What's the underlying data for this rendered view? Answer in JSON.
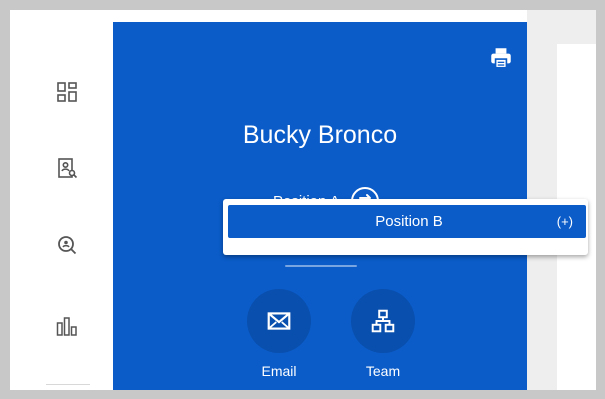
{
  "profile": {
    "name": "Bucky Bronco",
    "current_position": "Position A"
  },
  "dropdown": {
    "options": [
      {
        "label": "Position B",
        "badge": "(+)"
      }
    ]
  },
  "actions": [
    {
      "label": "Email",
      "icon": "envelope-icon"
    },
    {
      "label": "Team",
      "icon": "org-chart-icon"
    }
  ],
  "sidebar": {
    "icons": [
      "dashboard-grid-icon",
      "profile-search-icon",
      "search-person-icon",
      "bar-chart-icon"
    ]
  },
  "colors": {
    "profile_blue": "#0b5cc9",
    "circle_blue": "#094fad",
    "sidebar_icon": "#555555"
  }
}
